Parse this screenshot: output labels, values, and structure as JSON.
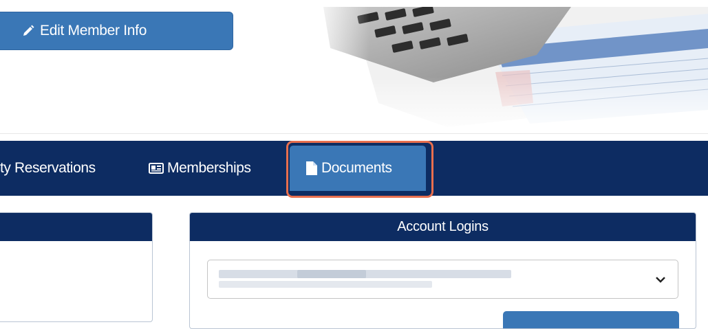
{
  "header": {
    "edit_button_label": "Edit Member Info"
  },
  "nav": {
    "items": [
      {
        "label": "ty Reservations"
      },
      {
        "label": "Memberships",
        "icon": "id-card-icon"
      },
      {
        "label": "Documents",
        "icon": "file-icon",
        "active": true
      }
    ]
  },
  "panels": {
    "account_logins": {
      "title": "Account Logins"
    }
  },
  "colors": {
    "navy": "#0d2c62",
    "button_blue": "#3a77b6",
    "highlight": "#e86f4e"
  }
}
